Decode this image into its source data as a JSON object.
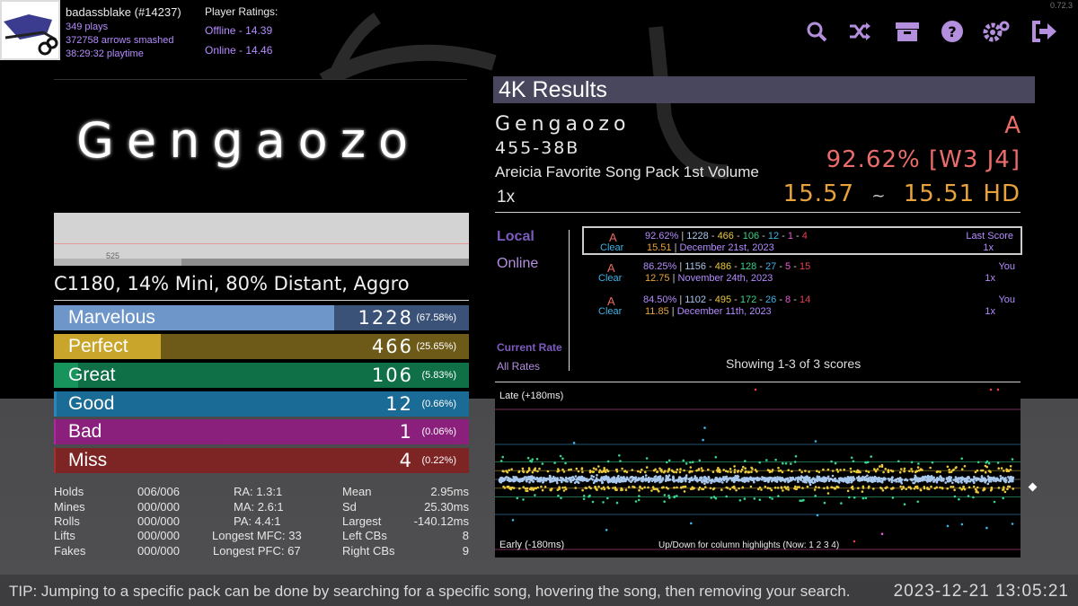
{
  "profile": {
    "name": "badassblake (#14237)",
    "plays": "349 plays",
    "arrows": "372758 arrows smashed",
    "playtime": "38:29:32 playtime"
  },
  "ratings": {
    "label": "Player Ratings:",
    "offline": "Offline - 14.39",
    "online": "Online - 14.46"
  },
  "toolbar": {
    "icons": [
      "search-icon",
      "shuffle-icon",
      "box-icon",
      "help-icon",
      "settings-icon",
      "exit-icon"
    ]
  },
  "version": "0.72.3",
  "banner_title": "Gengaozo",
  "graph_label": "525",
  "mods": "C1180, 14% Mini, 80% Distant, Aggro",
  "judgments": [
    {
      "label": "Marvelous",
      "count": "1228",
      "pct": "(67.58%)",
      "ratio": 0.6758,
      "bg": "#3a5277",
      "fill": "#6e96c9"
    },
    {
      "label": "Perfect",
      "count": "466",
      "pct": "(25.65%)",
      "ratio": 0.2565,
      "bg": "#6d5a19",
      "fill": "#c9a62b"
    },
    {
      "label": "Great",
      "count": "106",
      "pct": "(5.83%)",
      "ratio": 0.0583,
      "bg": "#0f7048",
      "fill": "#17935c"
    },
    {
      "label": "Good",
      "count": "12",
      "pct": "(0.66%)",
      "ratio": 0.0066,
      "bg": "#1a6b96",
      "fill": "#2c86b8"
    },
    {
      "label": "Bad",
      "count": "1",
      "pct": "(0.06%)",
      "ratio": 0.0006,
      "bg": "#8a1f7c",
      "fill": "#b0289e"
    },
    {
      "label": "Miss",
      "count": "4",
      "pct": "(0.22%)",
      "ratio": 0.0022,
      "bg": "#7d2424",
      "fill": "#a53030"
    }
  ],
  "stats": {
    "holds": {
      "label": "Holds",
      "value": "006/006"
    },
    "mines": {
      "label": "Mines",
      "value": "000/000"
    },
    "rolls": {
      "label": "Rolls",
      "value": "000/000"
    },
    "lifts": {
      "label": "Lifts",
      "value": "000/000"
    },
    "fakes": {
      "label": "Fakes",
      "value": "000/000"
    },
    "ra": "RA: 1.3:1",
    "ma": "MA: 2.6:1",
    "pa": "PA: 4.4:1",
    "mfc": "Longest MFC: 33",
    "pfc": "Longest PFC: 67",
    "mean": {
      "label": "Mean",
      "value": "2.95ms"
    },
    "sd": {
      "label": "Sd",
      "value": "25.30ms"
    },
    "largest": {
      "label": "Largest",
      "value": "-140.12ms"
    },
    "lcb": {
      "label": "Left CBs",
      "value": "8"
    },
    "rcb": {
      "label": "Right CBs",
      "value": "9"
    }
  },
  "results": {
    "header": "4K Results",
    "song": "Gengaozo",
    "artist": "455-38B",
    "pack": "Areicia Favorite Song Pack 1st Volume",
    "rate": "1x",
    "grade": "A",
    "percent": "92.62%",
    "judge": "[W3 J4]",
    "msd": "15.57",
    "tilde": "~",
    "ssr": "15.51",
    "hd": "HD"
  },
  "tabs": {
    "local": "Local",
    "online": "Online",
    "current_rate": "Current Rate",
    "all_rates": "All Rates"
  },
  "scores": [
    {
      "grade": "A",
      "clear": "Clear",
      "pct": "92.62%",
      "m": "1228",
      "p": "466",
      "g": "106",
      "gd": "12",
      "b": "1",
      "mi": "4",
      "ssr": "15.51",
      "date": "December 21st, 2023",
      "tag": "Last Score",
      "rate": "1x"
    },
    {
      "grade": "A",
      "clear": "Clear",
      "pct": "86.25%",
      "m": "1156",
      "p": "486",
      "g": "128",
      "gd": "27",
      "b": "5",
      "mi": "15",
      "ssr": "12.75",
      "date": "November 24th, 2023",
      "tag": "You",
      "rate": "1x"
    },
    {
      "grade": "A",
      "clear": "Clear",
      "pct": "84.50%",
      "m": "1102",
      "p": "495",
      "g": "172",
      "gd": "26",
      "b": "8",
      "mi": "14",
      "ssr": "11.85",
      "date": "December 11th, 2023",
      "tag": "You",
      "rate": "1x"
    }
  ],
  "showing": "Showing 1-3 of 3 scores",
  "offset_plot": {
    "late": "Late (+180ms)",
    "early": "Early (-180ms)",
    "hint": "Up/Down for column highlights (Now: 1 2 3 4)"
  },
  "chart_data": {
    "type": "scatter",
    "title": "",
    "xlabel": "",
    "ylabel": "",
    "ylim": [
      -180,
      180
    ],
    "series": [
      {
        "name": "Marvelous",
        "count": 1228
      },
      {
        "name": "Perfect",
        "count": 466
      },
      {
        "name": "Great",
        "count": 106
      },
      {
        "name": "Good",
        "count": 12
      },
      {
        "name": "Bad",
        "count": 1
      },
      {
        "name": "Miss",
        "count": 4
      }
    ]
  },
  "colors": {
    "marvelous": "#a9c8ee",
    "perfect": "#eac93e",
    "great": "#3ad38b",
    "good": "#3fb3e5",
    "bad": "#e85ad2",
    "miss": "#e4414f",
    "accent": "#b48fde"
  },
  "tip": "TIP: Jumping to a specific pack can be done by searching for a specific song, hovering the song, then removing your search.",
  "clock": "2023-12-21 13:05:21"
}
